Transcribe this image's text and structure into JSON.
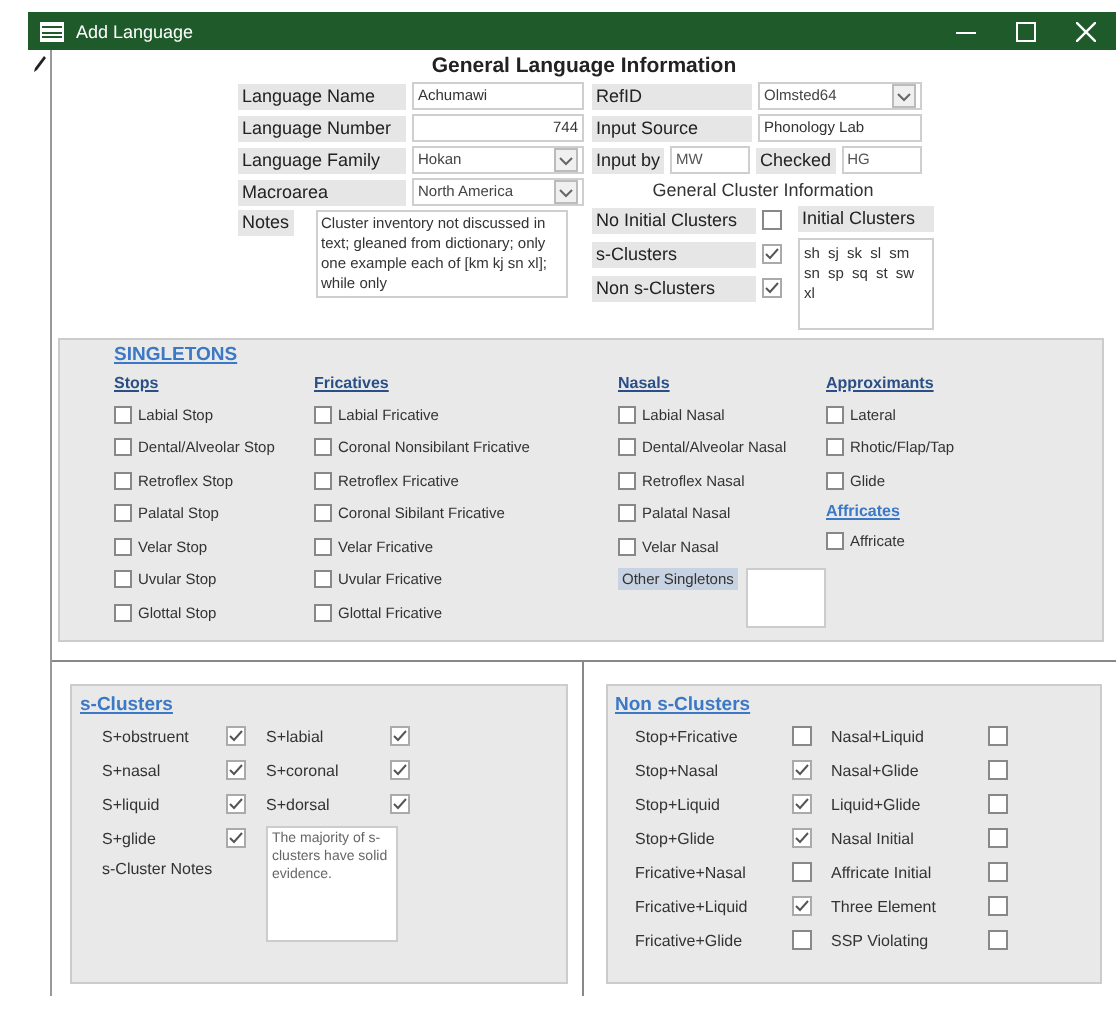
{
  "window": {
    "title": "Add Language"
  },
  "general": {
    "title": "General Language Information",
    "left": [
      {
        "label": "Language Name",
        "value": "Achumawi",
        "kind": "text"
      },
      {
        "label": "Language Number",
        "value": "744",
        "kind": "number"
      },
      {
        "label": "Language Family",
        "value": "Hokan",
        "kind": "dropdown"
      },
      {
        "label": "Macroarea",
        "value": "North America",
        "kind": "dropdown"
      }
    ],
    "notes": {
      "label": "Notes",
      "value": "Cluster inventory not discussed in text; gleaned from dictionary; only one example each of [km kj sn xl]; while only"
    },
    "right": [
      {
        "label": "RefID",
        "value": "Olmsted64",
        "kind": "dropdown"
      },
      {
        "label": "Input Source",
        "value": "Phonology Lab",
        "kind": "text"
      }
    ],
    "input_by": {
      "label": "Input by",
      "value": "MW"
    },
    "checked_by": {
      "label": "Checked",
      "value": "HG"
    },
    "cluster_info": {
      "title": "General Cluster Information",
      "flags": [
        {
          "label": "No Initial Clusters",
          "checked": false
        },
        {
          "label": "s-Clusters",
          "checked": true
        },
        {
          "label": "Non s-Clusters",
          "checked": true
        }
      ],
      "initial_clusters": {
        "label": "Initial Clusters",
        "value": "sh sj sk sl sm sn sp sq st sw xl"
      }
    }
  },
  "singletons": {
    "title": "SINGLETONS",
    "columns": [
      {
        "groups": [
          {
            "heading": "Stops",
            "items": [
              {
                "label": "Labial Stop",
                "checked": false
              },
              {
                "label": "Dental/Alveolar Stop",
                "checked": false
              },
              {
                "label": "Retroflex Stop",
                "checked": false
              },
              {
                "label": "Palatal Stop",
                "checked": false
              },
              {
                "label": "Velar Stop",
                "checked": false
              },
              {
                "label": "Uvular Stop",
                "checked": false
              },
              {
                "label": "Glottal Stop",
                "checked": false
              }
            ]
          }
        ]
      },
      {
        "groups": [
          {
            "heading": "Fricatives",
            "items": [
              {
                "label": "Labial Fricative",
                "checked": false
              },
              {
                "label": "Coronal Nonsibilant Fricative",
                "checked": false
              },
              {
                "label": "Retroflex Fricative",
                "checked": false
              },
              {
                "label": "Coronal Sibilant Fricative",
                "checked": false
              },
              {
                "label": "Velar Fricative",
                "checked": false
              },
              {
                "label": "Uvular Fricative",
                "checked": false
              },
              {
                "label": "Glottal Fricative",
                "checked": false
              }
            ]
          }
        ]
      },
      {
        "groups": [
          {
            "heading": "Nasals",
            "items": [
              {
                "label": "Labial Nasal",
                "checked": false
              },
              {
                "label": "Dental/Alveolar Nasal",
                "checked": false
              },
              {
                "label": "Retroflex Nasal",
                "checked": false
              },
              {
                "label": "Palatal Nasal",
                "checked": false
              },
              {
                "label": "Velar Nasal",
                "checked": false
              }
            ]
          }
        ],
        "other": {
          "label": "Other Singletons"
        }
      },
      {
        "groups": [
          {
            "heading": "Approximants",
            "items": [
              {
                "label": "Lateral",
                "checked": false
              },
              {
                "label": "Rhotic/Flap/Tap",
                "checked": false
              },
              {
                "label": "Glide",
                "checked": false
              }
            ]
          },
          {
            "heading": "Affricates",
            "items": [
              {
                "label": "Affricate",
                "checked": false
              }
            ]
          }
        ]
      }
    ]
  },
  "s_clusters": {
    "title": "s-Clusters",
    "items": [
      {
        "label": "S+obstruent",
        "checked": true
      },
      {
        "label": "S+labial",
        "checked": true
      },
      {
        "label": "S+nasal",
        "checked": true
      },
      {
        "label": "S+coronal",
        "checked": true
      },
      {
        "label": "S+liquid",
        "checked": true
      },
      {
        "label": "S+dorsal",
        "checked": true
      },
      {
        "label": "S+glide",
        "checked": true
      }
    ],
    "notes": {
      "label": "s-Cluster Notes",
      "value": "The majority of s-clusters have solid evidence."
    }
  },
  "non_s_clusters": {
    "title": "Non s-Clusters",
    "items": [
      {
        "label": "Stop+Fricative",
        "checked": false
      },
      {
        "label": "Nasal+Liquid",
        "checked": false
      },
      {
        "label": "Stop+Nasal",
        "checked": true
      },
      {
        "label": "Nasal+Glide",
        "checked": false
      },
      {
        "label": "Stop+Liquid",
        "checked": true
      },
      {
        "label": "Liquid+Glide",
        "checked": false
      },
      {
        "label": "Stop+Glide",
        "checked": true
      },
      {
        "label": "Nasal Initial",
        "checked": false
      },
      {
        "label": "Fricative+Nasal",
        "checked": false
      },
      {
        "label": "Affricate Initial",
        "checked": false
      },
      {
        "label": "Fricative+Liquid",
        "checked": true
      },
      {
        "label": "Three Element",
        "checked": false
      },
      {
        "label": "Fricative+Glide",
        "checked": false
      },
      {
        "label": "SSP Violating",
        "checked": false
      }
    ]
  }
}
